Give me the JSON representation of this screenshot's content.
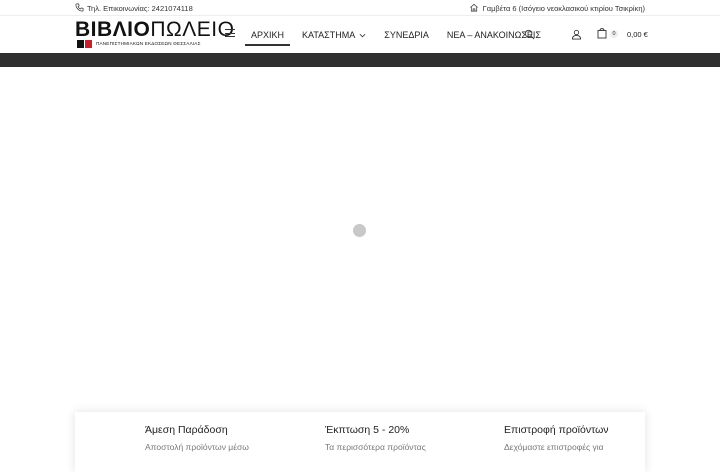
{
  "topbar": {
    "phone": "Τηλ. Επικοινωνίας: 2421074118",
    "address": "Γαμβέτα 6 (Ισόγειο νεοκλασικού κτιρίου Τσικρίκη)"
  },
  "logo": {
    "word_bold": "ΒΙΒΛΙΟ",
    "word_thin": "ΠΩΛΕΙΟ",
    "subtitle": "ΠΑΝΕΠΙΣΤΗΜΙΑΚΩΝ ΕΚΔΟΣΕΩΝ ΘΕΣΣΑΛΙΑΣ"
  },
  "nav": {
    "home": "ΑΡΧΙΚΗ",
    "store": "ΚΑΤΑΣΤΗΜΑ",
    "conferences": "ΣΥΝΕΔΡΙΑ",
    "news": "ΝΕΑ – ΑΝΑΚΟΙΝΩΣΕΙΣ"
  },
  "cart": {
    "count": "0",
    "total": "0,00 €"
  },
  "features": [
    {
      "title": "Άμεση Παράδοση",
      "desc": "Αποστολή προϊόντων μέσω"
    },
    {
      "title": "Έκπτωση 5 - 20%",
      "desc": "Τα περισσότερα προϊόντας"
    },
    {
      "title": "Επιστροφή προϊόντων",
      "desc": "Δεχόμαστε επιστροφές για"
    }
  ],
  "colors": {
    "dark_bar": "#2f2f2f",
    "brand_red": "#c8202a"
  }
}
